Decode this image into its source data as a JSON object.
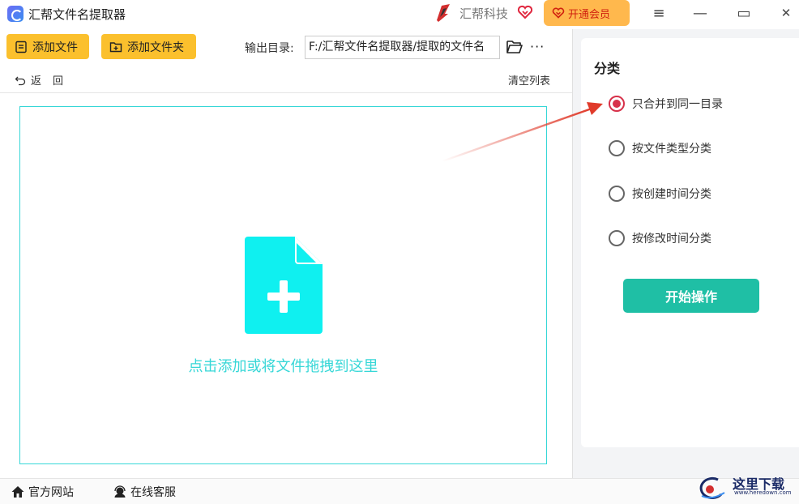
{
  "titlebar": {
    "app_title": "汇帮文件名提取器",
    "brand": "汇帮科技",
    "vip_label": "开通会员",
    "menu_glyph": "≡",
    "minimize_glyph": "—",
    "maximize_glyph": "▭",
    "close_glyph": "✕"
  },
  "toolbar": {
    "add_file_label": "添加文件",
    "add_folder_label": "添加文件夹",
    "output_label": "输出目录:",
    "output_value": "F:/汇帮文件名提取器/提取的文件名",
    "more_glyph": "···",
    "back_label": "返回",
    "clear_label": "清空列表"
  },
  "dropzone": {
    "hint": "点击添加或将文件拖拽到这里"
  },
  "panel": {
    "title": "分类",
    "options": [
      {
        "label": "只合并到同一目录",
        "selected": true
      },
      {
        "label": "按文件类型分类",
        "selected": false
      },
      {
        "label": "按创建时间分类",
        "selected": false
      },
      {
        "label": "按修改时间分类",
        "selected": false
      }
    ],
    "start_label": "开始操作"
  },
  "bottombar": {
    "website_label": "官方网站",
    "support_label": "在线客服"
  },
  "watermark": {
    "text": "这里下载",
    "url": "www.heredown.com"
  },
  "colors": {
    "accent_yellow": "#fbc02d",
    "drop_cyan": "#36d7d7",
    "start_green": "#1fbfa5",
    "radio_red": "#d7314a",
    "arrow_red": "#e03a2a"
  }
}
